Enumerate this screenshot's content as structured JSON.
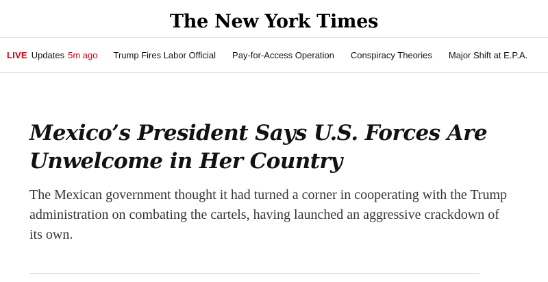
{
  "masthead": {
    "logo_text": "The New York Times"
  },
  "nav": {
    "live_label": "LIVE",
    "live_text": "Updates",
    "live_time": "5m ago",
    "links": [
      "Trump Fires Labor Official",
      "Pay-for-Access Operation",
      "Conspiracy Theories",
      "Major Shift at E.P.A."
    ]
  },
  "article": {
    "headline_line1": "Mexico’s President Says U.S. Forces Are",
    "headline_line2": "Unwelcome in Her Country",
    "summary": "The Mexican government thought it had turned a corner in cooperating with the Trump administration on combating the cartels, having launched an aggressive crackdown of its own."
  },
  "colors": {
    "live_red": "#d0021b",
    "text": "#121212",
    "summary_text": "#363636",
    "rule": "#e2e2e2"
  }
}
